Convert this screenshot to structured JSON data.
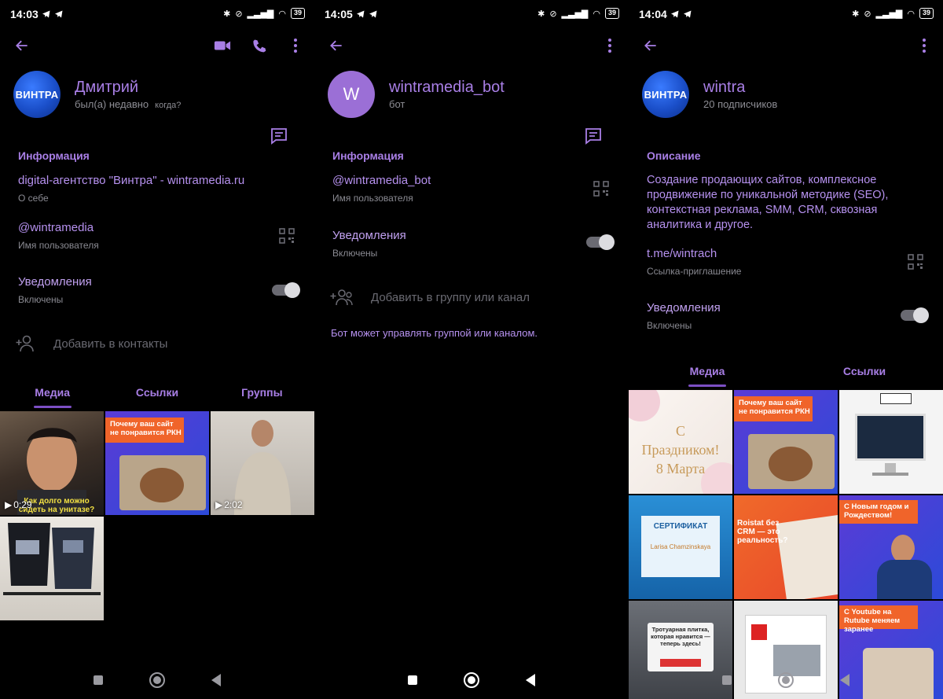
{
  "panels": [
    {
      "status": {
        "time": "14:03",
        "battery": "39"
      },
      "avatar_text": "ВИНТРА",
      "name": "Дмитрий",
      "subtitle": "был(а) недавно",
      "subtitle_hint": "когда?",
      "info_title": "Информация",
      "bio_value": "digital-агентство \"Винтра\" - wintramedia.ru",
      "bio_label": "О себе",
      "username_value": "@wintramedia",
      "username_label": "Имя пользователя",
      "notif_value": "Уведомления",
      "notif_label": "Включены",
      "add_contact": "Добавить в контакты",
      "tabs": [
        "Медиа",
        "Ссылки",
        "Группы"
      ],
      "media": [
        {
          "caption": "Как долго можно сидеть на унитазе?",
          "duration": "0:29"
        },
        {
          "caption": "Почему ваш сайт не понравится РКН",
          "duration": ""
        },
        {
          "caption": "",
          "duration": "2:02"
        },
        {
          "caption": "",
          "duration": ""
        }
      ]
    },
    {
      "status": {
        "time": "14:05",
        "battery": "39"
      },
      "avatar_text": "W",
      "name": "wintramedia_bot",
      "subtitle": "бот",
      "info_title": "Информация",
      "username_value": "@wintramedia_bot",
      "username_label": "Имя пользователя",
      "notif_value": "Уведомления",
      "notif_label": "Включены",
      "add_group": "Добавить в группу или канал",
      "note": "Бот может управлять группой или каналом."
    },
    {
      "status": {
        "time": "14:04",
        "battery": "39"
      },
      "avatar_text": "ВИНТРА",
      "name": "wintra",
      "subtitle": "20 подписчиков",
      "desc_title": "Описание",
      "desc": "Создание продающих сайтов, комплексное продвижение по уникальной методике (SEO), контекстная реклама, SMM, CRM, сквозная аналитика и другое.",
      "link_value": "t.me/wintrach",
      "link_label": "Ссылка-приглашение",
      "notif_value": "Уведомления",
      "notif_label": "Включены",
      "tabs": [
        "Медиа",
        "Ссылки"
      ],
      "media": [
        {
          "caption": "С Праздником! 8 Марта"
        },
        {
          "caption": "Почему ваш сайт не понравится РКН"
        },
        {
          "caption": ""
        },
        {
          "caption": "СЕРТИФИКАТ",
          "sub": "Larisa Chamzinskaya"
        },
        {
          "caption": "Roistat без CRM — это реальность?"
        },
        {
          "caption": "С Новым годом и Рождеством!"
        },
        {
          "caption": "Тротуарная плитка, которая нравится — теперь здесь!"
        },
        {
          "caption": ""
        },
        {
          "caption": "С Youtube на Rutube меняем заранее"
        }
      ]
    }
  ],
  "colors": {
    "accent": "#a97fe6",
    "background": "#000000",
    "muted": "#8d8d94"
  }
}
